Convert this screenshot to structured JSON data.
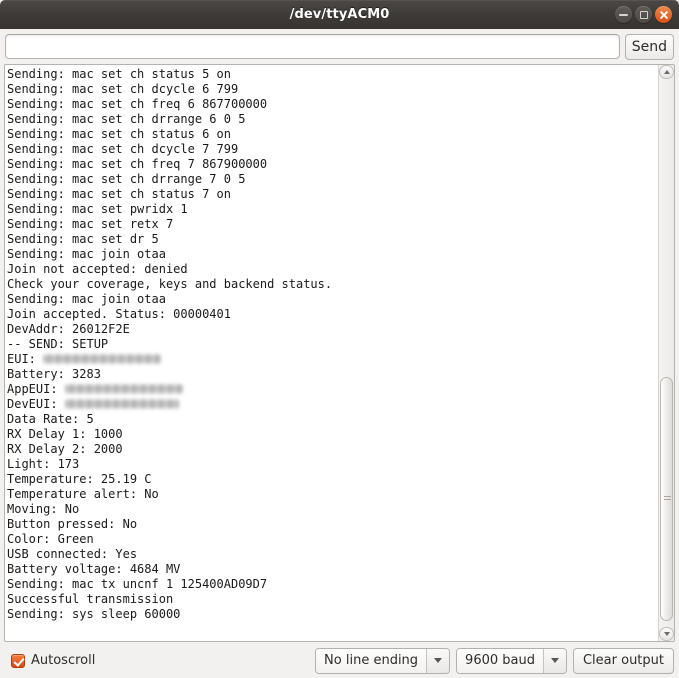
{
  "window": {
    "title": "/dev/ttyACM0",
    "controls": {
      "minimize": "minimize",
      "maximize": "maximize",
      "close": "close"
    }
  },
  "send_row": {
    "input_value": "",
    "input_placeholder": "",
    "send_label": "Send"
  },
  "console": {
    "lines": [
      {
        "text": "Sending: mac set ch status 5 on"
      },
      {
        "text": "Sending: mac set ch dcycle 6 799"
      },
      {
        "text": "Sending: mac set ch freq 6 867700000"
      },
      {
        "text": "Sending: mac set ch drrange 6 0 5"
      },
      {
        "text": "Sending: mac set ch status 6 on"
      },
      {
        "text": "Sending: mac set ch dcycle 7 799"
      },
      {
        "text": "Sending: mac set ch freq 7 867900000"
      },
      {
        "text": "Sending: mac set ch drrange 7 0 5"
      },
      {
        "text": "Sending: mac set ch status 7 on"
      },
      {
        "text": "Sending: mac set pwridx 1"
      },
      {
        "text": "Sending: mac set retx 7"
      },
      {
        "text": "Sending: mac set dr 5"
      },
      {
        "text": "Sending: mac join otaa"
      },
      {
        "text": "Join not accepted: denied"
      },
      {
        "text": "Check your coverage, keys and backend status."
      },
      {
        "text": "Sending: mac join otaa"
      },
      {
        "text": "Join accepted. Status: 00000401"
      },
      {
        "text": "DevAddr: 26012F2E"
      },
      {
        "text": "-- SEND: SETUP"
      },
      {
        "text": "EUI: ",
        "redacted_width": 118
      },
      {
        "text": "Battery: 3283"
      },
      {
        "text": "AppEUI: ",
        "redacted_width": 118
      },
      {
        "text": "DevEUI: ",
        "redacted_width": 114
      },
      {
        "text": "Data Rate: 5"
      },
      {
        "text": "RX Delay 1: 1000"
      },
      {
        "text": "RX Delay 2: 2000"
      },
      {
        "text": "Light: 173"
      },
      {
        "text": "Temperature: 25.19 C"
      },
      {
        "text": "Temperature alert: No"
      },
      {
        "text": "Moving: No"
      },
      {
        "text": "Button pressed: No"
      },
      {
        "text": "Color: Green"
      },
      {
        "text": "USB connected: Yes"
      },
      {
        "text": "Battery voltage: 4684 MV"
      },
      {
        "text": "Sending: mac tx uncnf 1 125400AD09D7"
      },
      {
        "text": "Successful transmission"
      },
      {
        "text": "Sending: sys sleep 60000"
      }
    ]
  },
  "bottom_bar": {
    "autoscroll_label": "Autoscroll",
    "autoscroll_checked": true,
    "line_ending": {
      "selected": "No line ending"
    },
    "baud_rate": {
      "selected": "9600 baud"
    },
    "clear_label": "Clear output"
  },
  "colors": {
    "titlebar": "#3d3a37",
    "close_button": "#dd4814",
    "checkbox_accent": "#dd4814",
    "console_background": "#ffffff",
    "console_text": "#1a1a1a",
    "chrome_background": "#f2f1f0"
  }
}
